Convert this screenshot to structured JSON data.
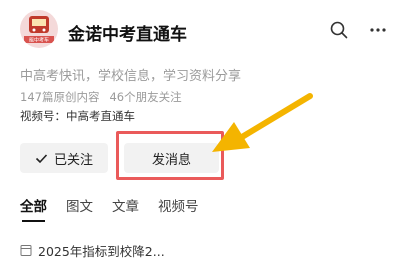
{
  "account": {
    "name": "金诺中考直通车",
    "avatar_text": "能中考车",
    "description": "中高考快讯，学校信息，学习资料分享",
    "original_count": "147篇原创内容",
    "friends_following": "46个朋友关注",
    "channel": "视频号：中高考直通车"
  },
  "header_icons": [
    "search-icon",
    "more-icon"
  ],
  "actions": {
    "followed_label": "已关注",
    "message_label": "发消息"
  },
  "tabs": [
    {
      "label": "全部",
      "active": true
    },
    {
      "label": "图文",
      "active": false
    },
    {
      "label": "文章",
      "active": false
    },
    {
      "label": "视频号",
      "active": false
    }
  ],
  "articles": [
    {
      "title": "2025年指标到校降2..."
    }
  ],
  "annotation": {
    "highlight_color": "#ea5a5a",
    "arrow_color": "#f4b400"
  }
}
